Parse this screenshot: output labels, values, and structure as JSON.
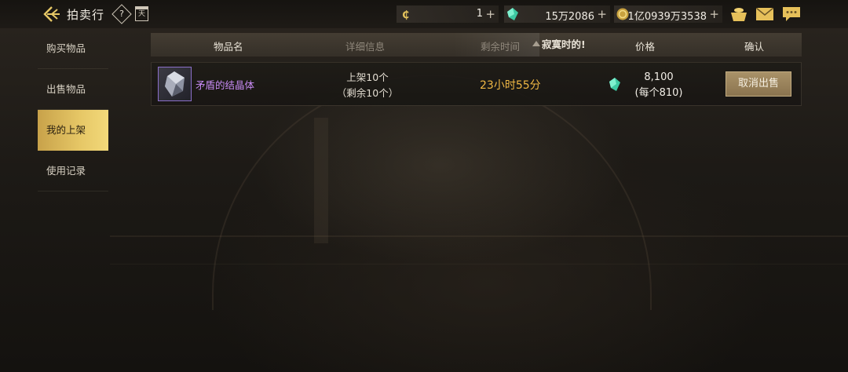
{
  "header": {
    "title": "拍卖行",
    "help_glyph": "?",
    "calendar_glyph": "天",
    "currencies": [
      {
        "icon": "c-coin-icon",
        "value": "1"
      },
      {
        "icon": "green-gem-icon",
        "value": "15万2086"
      },
      {
        "icon": "gold-coin-icon",
        "value": "1亿0939万3538"
      }
    ],
    "accent_gold": "#e6c766",
    "gem_color": "#3ec9a3"
  },
  "sidebar": {
    "items": [
      {
        "label": "购买物品",
        "active": false
      },
      {
        "label": "出售物品",
        "active": false
      },
      {
        "label": "我的上架",
        "active": true
      },
      {
        "label": "使用记录",
        "active": false
      }
    ]
  },
  "table": {
    "columns": {
      "item_name": "物品名",
      "detail": "详细信息",
      "time_left": "剩余时间",
      "lonely_time": "寂寞时的!",
      "price": "价格",
      "confirm": "确认"
    },
    "rows": [
      {
        "item_name": "矛盾的结晶体",
        "detail_line1": "上架10个",
        "detail_line2": "（剩余10个）",
        "time_left": "23小时55分",
        "price_total": "8,100",
        "price_each": "(每个810)",
        "action_label": "取消出售"
      }
    ]
  }
}
